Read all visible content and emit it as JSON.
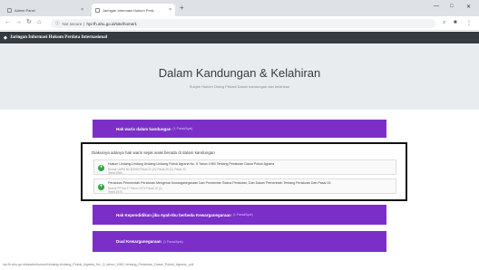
{
  "browser": {
    "tabs": [
      {
        "title": "Admin Panel"
      },
      {
        "title": "Jaringan Informasi Hukum Perd..."
      }
    ],
    "new_tab": "+",
    "address": {
      "security": "Not secure",
      "url": "hpi-fh.ahu.go.id/site/home/1"
    }
  },
  "site": {
    "brand": "Jaringan Informasi Hukum Perdata Internasional"
  },
  "hero": {
    "title": "Dalam Kandungan & Kelahiran",
    "subtitle": "Subjek Hukum Orang Pribadi Dalam kandungan dan kelahiran"
  },
  "accordion": [
    {
      "label": "Hak waris dalam kandungan",
      "badge": "(1 Pasal/Ayat)"
    },
    {
      "label": "Hak Kependidikan jika Ayah-Ibu berbeda Kewarganegaraan",
      "badge": "(1 Pasal/Ayat)"
    },
    {
      "label": "Dual Kewarganegaraan",
      "badge": "(1 Pasal/Ayat)"
    }
  ],
  "panel": {
    "question": "Diakuinya adanya hak waris sejak anak berada di dalam kandungan",
    "documents": [
      {
        "title": "Hukum Undang-Undang Undang-Undang Pokok Agraria No. 5 Tahun 1960 Tentang Peraturan Dasar Pokok Agraria",
        "meta": "Nomor UUPA No.5/1960 Pasal 21 (2); Pasal 26 (2); Pasal 30",
        "meta2": "Terbit 1960"
      },
      {
        "title": "Peraturan Pemerintah Peraturan Mengenai Kewarganegaraan Dan Pemberian Status Peraturan, Dan Dalam Pemerintah Tentang Peraturan Dan Pasal 15",
        "meta": "Nomor PP No.17 Tahun 1974 Pasal 10 (1)",
        "meta2": "Terbit 1974"
      }
    ]
  },
  "status_url": "hpi-fh.ahu.go.id/assets/hukum/Undang-Undang_Pokok_Agraria_No._5_tahun_1960_tentang_Peraturan_Dasar_Pokok_Agraria_.pdf",
  "colors": {
    "accent": "#7b2fc8",
    "navbar": "#343a40",
    "hero": "#e9ecef",
    "doc_icon": "#28a745"
  }
}
